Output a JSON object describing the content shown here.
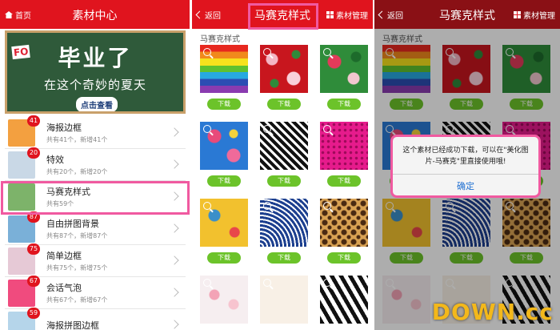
{
  "panel1": {
    "header": {
      "back_label": "首页",
      "title": "素材中心"
    },
    "banner": {
      "line1": "毕业了",
      "line2": "在这个奇妙的夏天",
      "cta": "点击查看",
      "corner_tag": "FO"
    },
    "items": [
      {
        "name": "海报边框",
        "sub": "共有41个，新增41个",
        "badge": "41",
        "color": "#f3a040"
      },
      {
        "name": "特效",
        "sub": "共有20个，新增20个",
        "badge": "20",
        "color": "#c9d8e6"
      },
      {
        "name": "马赛克样式",
        "sub": "共有59个",
        "badge": "",
        "color": "#7db36a"
      },
      {
        "name": "自由拼图背景",
        "sub": "共有87个，新增87个",
        "badge": "87",
        "color": "#7ab0d8"
      },
      {
        "name": "简单边框",
        "sub": "共有75个，新增75个",
        "badge": "75",
        "color": "#e6c9d6"
      },
      {
        "name": "会话气泡",
        "sub": "共有67个，新增67个",
        "badge": "67",
        "color": "#f04b7e"
      },
      {
        "name": "海报拼图边框",
        "sub": "",
        "badge": "59",
        "color": "#b5d5ea"
      }
    ]
  },
  "panel2": {
    "header": {
      "back_label": "返回",
      "title": "马赛克样式",
      "right_label": "素材管理"
    },
    "section_title": "马赛克样式",
    "download_label": "下载",
    "tiles": [
      "rainbow",
      "rose",
      "rose2",
      "blueflower",
      "bw",
      "pink",
      "yellowfloral",
      "wave",
      "leopard",
      "whitefloral",
      "xi",
      "zebra"
    ]
  },
  "panel3": {
    "header": {
      "back_label": "返回",
      "title": "马赛克样式",
      "right_label": "素材管理"
    },
    "section_title": "马赛克样式",
    "download_label": "下载",
    "dialog": {
      "message": "这个素材已经成功下载，可以在\"美化图片-马赛克\"里直接使用哦!",
      "ok_label": "确定"
    },
    "watermark_main": "DOWN",
    "watermark_suffix": ".cc"
  },
  "colors": {
    "header_red": "#e0141e",
    "download_green": "#6cc32a",
    "highlight_pink": "#f05aa0",
    "link_blue": "#1f6fd1"
  }
}
